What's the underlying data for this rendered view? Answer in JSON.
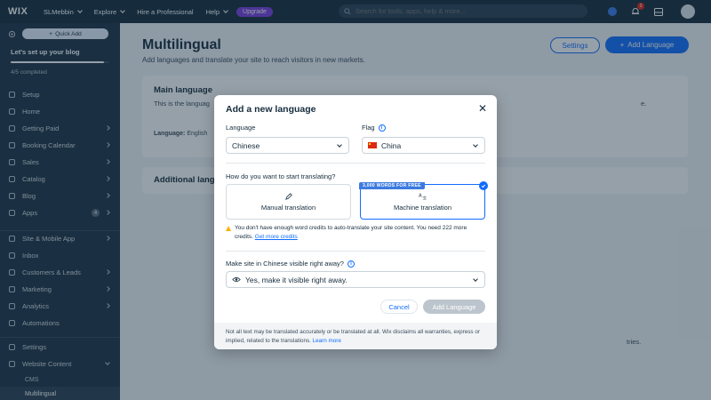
{
  "topbar": {
    "logo": "WIX",
    "site_name": "SLMebbin",
    "explore": "Explore",
    "hire": "Hire a Professional",
    "help": "Help",
    "upgrade": "Upgrade",
    "search_placeholder": "Search for tools, apps, help & more...",
    "notification_count": "3"
  },
  "sidebar": {
    "quick_add": "Quick Add",
    "setup_title": "Let's set up your blog",
    "setup_progress": 0.95,
    "setup_completed": "4/5 completed",
    "items": [
      {
        "label": "Setup",
        "arrow": false
      },
      {
        "label": "Home",
        "arrow": false
      },
      {
        "label": "Getting Paid",
        "arrow": true
      },
      {
        "label": "Booking Calendar",
        "arrow": true
      },
      {
        "label": "Sales",
        "arrow": true
      },
      {
        "label": "Catalog",
        "arrow": true
      },
      {
        "label": "Blog",
        "arrow": true
      },
      {
        "label": "Apps",
        "arrow": true,
        "badge": "4"
      }
    ],
    "items2": [
      {
        "label": "Site & Mobile App",
        "arrow": true
      },
      {
        "label": "Inbox",
        "arrow": false
      },
      {
        "label": "Customers & Leads",
        "arrow": true
      },
      {
        "label": "Marketing",
        "arrow": true
      },
      {
        "label": "Analytics",
        "arrow": true
      },
      {
        "label": "Automations",
        "arrow": false
      }
    ],
    "items3": [
      {
        "label": "Settings",
        "arrow": false
      },
      {
        "label": "Website Content",
        "arrow": true
      }
    ],
    "sub_items": [
      "CMS",
      "Multilingual"
    ]
  },
  "page": {
    "title": "Multilingual",
    "subtitle": "Add languages and translate your site to reach visitors in new markets.",
    "settings_button": "Settings",
    "add_language_button": "Add Language",
    "main_language_title": "Main language",
    "main_language_text": "This is the languag",
    "main_language_text_tail": "e.",
    "language_label": "Language:",
    "language_value": "English",
    "additional_title": "Additional lang",
    "bg_tail": "tries."
  },
  "modal": {
    "title": "Add a new language",
    "language_label": "Language",
    "language_value": "Chinese",
    "flag_label": "Flag",
    "flag_value": "China",
    "translate_question": "How do you want to start translating?",
    "manual_label": "Manual translation",
    "machine_label": "Machine translation",
    "machine_badge": "3,000 WORDS FOR FREE",
    "warning_text": "You don't have enough word credits to auto-translate your site content. You need 222 more credits.",
    "warning_link": "Get more credits",
    "visible_question": "Make site in Chinese visible right away?",
    "visible_value": "Yes, make it visible right away.",
    "cancel_button": "Cancel",
    "add_button": "Add Language",
    "disclaimer": "Not all text may be translated accurately or be translated at all. Wix disclaims all warranties, express or implied, related to the translations.",
    "disclaimer_link": "Learn more"
  },
  "colors": {
    "accent": "#116dff",
    "topbar": "#162d3d",
    "sidebar": "#1e3445",
    "upgrade": "#7a3ce0",
    "warning": "#fdb10c"
  }
}
